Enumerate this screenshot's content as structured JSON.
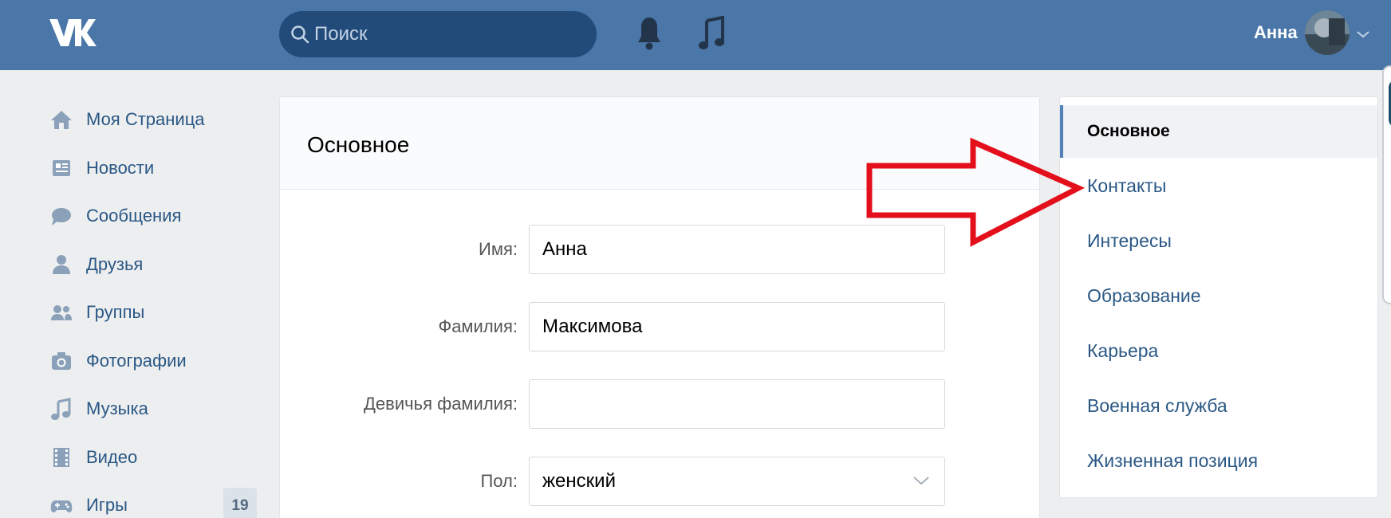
{
  "header": {
    "search_placeholder": "Поиск",
    "user_name": "Анна"
  },
  "sidebar": {
    "items": [
      {
        "label": "Моя Страница",
        "icon": "home-icon"
      },
      {
        "label": "Новости",
        "icon": "news-icon"
      },
      {
        "label": "Сообщения",
        "icon": "messages-icon"
      },
      {
        "label": "Друзья",
        "icon": "friend-icon"
      },
      {
        "label": "Группы",
        "icon": "groups-icon"
      },
      {
        "label": "Фотографии",
        "icon": "camera-icon"
      },
      {
        "label": "Музыка",
        "icon": "music-note-icon"
      },
      {
        "label": "Видео",
        "icon": "film-icon"
      },
      {
        "label": "Игры",
        "icon": "gamepad-icon",
        "count": "19"
      }
    ]
  },
  "main": {
    "title": "Основное",
    "fields": {
      "first_name": {
        "label": "Имя:",
        "value": "Анна"
      },
      "last_name": {
        "label": "Фамилия:",
        "value": "Максимова"
      },
      "maiden_name": {
        "label": "Девичья фамилия:",
        "value": ""
      },
      "gender": {
        "label": "Пол:",
        "value": "женский"
      }
    }
  },
  "right_menu": {
    "items": [
      "Основное",
      "Контакты",
      "Интересы",
      "Образование",
      "Карьера",
      "Военная служба",
      "Жизненная позиция"
    ],
    "active": "Основное"
  },
  "colors": {
    "header_bg": "#4a76a8",
    "search_bg": "#224b7a",
    "link": "#2a5885",
    "annotation_arrow": "#e3101c"
  }
}
